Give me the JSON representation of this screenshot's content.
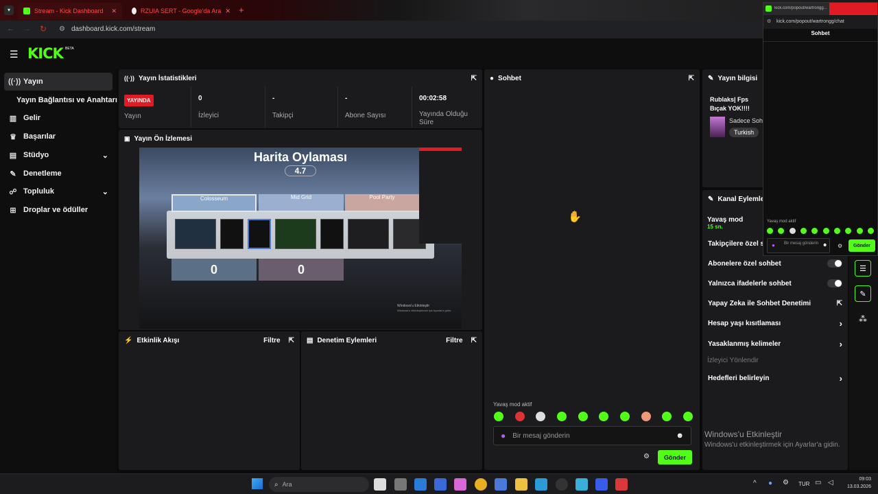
{
  "browser": {
    "tabs": [
      {
        "label": "Stream - Kick Dashboard"
      },
      {
        "label": "RZUIA SERT - Google'da Ara"
      }
    ],
    "address": "dashboard.kick.com/stream"
  },
  "popout": {
    "address": "kick.com/popout/wartrongg/chat",
    "title_tab": "kick.com/popout/wartrongg...",
    "header": "Sohbet",
    "slow_mode": "Yavaş mod aktif",
    "placeholder": "Bir mesaj gönderin",
    "send": "Gönder"
  },
  "logo": "KICK",
  "logo_badge": "BETA",
  "sidebar": {
    "items": [
      {
        "label": "Yayın",
        "icon": "broadcast-icon"
      },
      {
        "label": "Yayın Bağlantısı ve Anahtarı",
        "icon": ""
      },
      {
        "label": "Gelir",
        "icon": "chart-icon"
      },
      {
        "label": "Başarılar",
        "icon": "trophy-icon"
      },
      {
        "label": "Stüdyo",
        "icon": "studio-icon"
      },
      {
        "label": "Denetleme",
        "icon": "wrench-icon"
      },
      {
        "label": "Topluluk",
        "icon": "community-icon"
      },
      {
        "label": "Droplar ve ödüller",
        "icon": "gift-icon"
      }
    ]
  },
  "stats": {
    "title": "Yayın İstatistikleri",
    "live_badge": "YAYINDA",
    "columns": [
      {
        "value": "",
        "label": "Yayın"
      },
      {
        "value": "0",
        "label": "İzleyici"
      },
      {
        "value": "-",
        "label": "Takipçi"
      },
      {
        "value": "-",
        "label": "Abone Sayısı"
      },
      {
        "value": "00:02:58",
        "label": "Yayında Olduğu Süre"
      }
    ]
  },
  "preview": {
    "title": "Yayın Ön İzlemesi",
    "game_title": "Harita Oylaması",
    "rating": "4.7",
    "maps": [
      "Colosseum",
      "Mid Grid",
      "Pool Party"
    ],
    "scores": [
      "0",
      "0"
    ],
    "watermark1": "Windows'u Etkinleştir",
    "watermark2": "Windows'u etkinleştirmek için Ayarlar'a gidin."
  },
  "activity": {
    "title": "Etkinlik Akışı",
    "filter": "Filtre"
  },
  "moderation": {
    "title": "Denetim Eylemleri",
    "filter": "Filtre"
  },
  "chat": {
    "title": "Sohbet",
    "slow_mode": "Yavaş mod aktif",
    "placeholder": "Bir mesaj gönderin",
    "send": "Gönder"
  },
  "stream_info": {
    "title": "Yayın bilgisi",
    "stream_title": "Rublaks| Fps Bıçak YOK!!!!",
    "category": "Sadece Sohbet",
    "tag": "Turkish"
  },
  "channel_actions": {
    "title": "Kanal Eylemleri",
    "slow_mode": "Yavaş mod",
    "slow_value": "15 sn.",
    "items": [
      {
        "label": "Takipçilere özel sohbet",
        "kind": "toggle"
      },
      {
        "label": "Abonelere özel sohbet",
        "kind": "toggle"
      },
      {
        "label": "Yalnızca ifadelerle sohbet",
        "kind": "toggle"
      },
      {
        "label": "Yapay Zeka ile Sohbet Denetimi",
        "kind": "external"
      },
      {
        "label": "Hesap yaşı kısıtlaması",
        "kind": "chevron"
      },
      {
        "label": "Yasaklanmış kelimeler",
        "kind": "chevron"
      }
    ],
    "muted_label": "İzleyici Yönlendir",
    "last_item": "Hedefleri belirleyin"
  },
  "windows_watermark": {
    "line1": "Windows'u Etkinleştir",
    "line2": "Windows'u etkinleştirmek için Ayarlar'a gidin."
  },
  "taskbar": {
    "search": "Ara",
    "lang": "TUR",
    "time": "09:03",
    "date": "13.03.2026"
  },
  "colors": {
    "accent": "#53fc18",
    "live": "#e01b24",
    "panel": "#1b1b1d"
  }
}
